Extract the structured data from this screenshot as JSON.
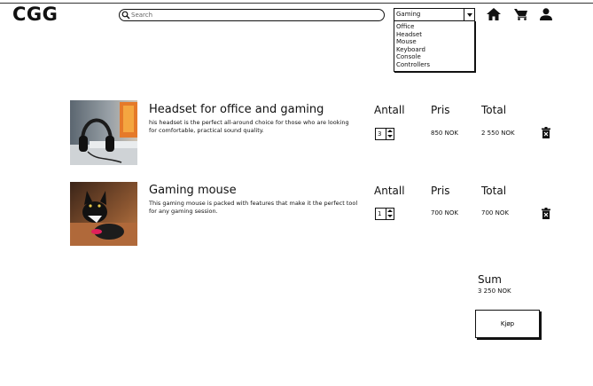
{
  "header": {
    "logo": "CGG",
    "search": {
      "placeholder": "Search",
      "value": ""
    },
    "category_select": {
      "selected": "Gaming"
    },
    "category_options": [
      "Office",
      "Headset",
      "Mouse",
      "Keyboard",
      "Console",
      "Controllers"
    ],
    "icons": [
      "home-icon",
      "cart-icon",
      "user-icon"
    ]
  },
  "cart": {
    "headers": {
      "quantity": "Antall",
      "price": "Pris",
      "total": "Total"
    },
    "items": [
      {
        "title": "Headset for office and gaming",
        "description": "his headset is the perfect all-around choice for those who are looking for comfortable, practical sound quality.",
        "quantity": "3",
        "price": "850 NOK",
        "total": "2 550 NOK"
      },
      {
        "title": "Gaming mouse",
        "description": "This gaming mouse is packed with features that make it the perfect tool for any gaming session.",
        "quantity": "1",
        "price": "700 NOK",
        "total": "700 NOK"
      }
    ],
    "sum": {
      "label": "Sum",
      "value": "3 250 NOK"
    },
    "buy_label": "Kjøp"
  },
  "colors": {
    "text": "#111111",
    "background": "#ffffff",
    "border": "#111111"
  }
}
